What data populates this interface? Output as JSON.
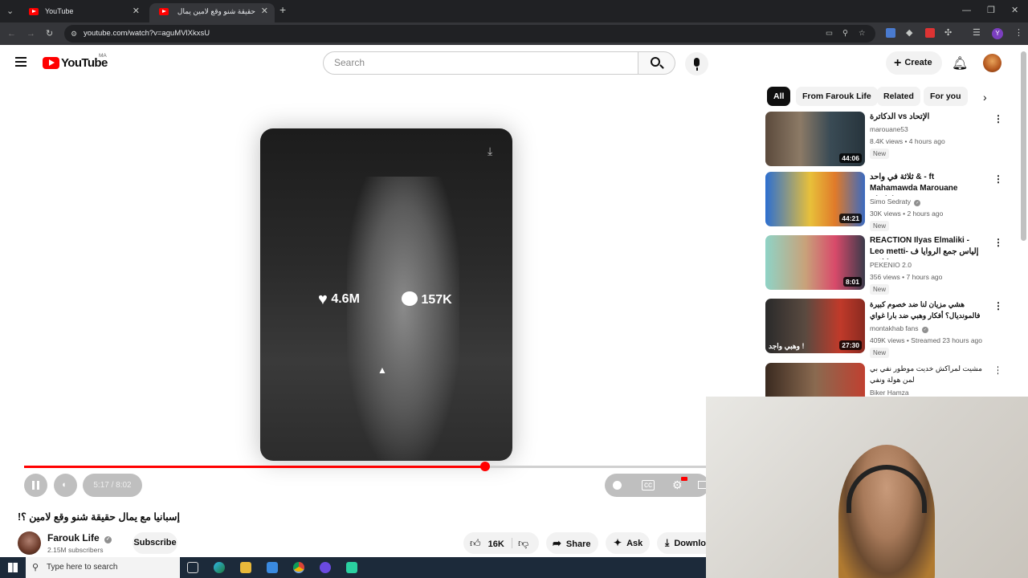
{
  "browser": {
    "tabs": [
      {
        "label": "YouTube"
      },
      {
        "label": "حقيقة شنو وقع لامين يمال ..."
      }
    ],
    "url": "youtube.com/watch?v=aguMVlXkxsU"
  },
  "yt": {
    "logo_text": "YouTube",
    "region": "MA",
    "search_placeholder": "Search",
    "create_label": "Create"
  },
  "player": {
    "likes": "4.6M",
    "comments": "157K",
    "time": "5:17 / 8:02",
    "progress": 0.66
  },
  "video": {
    "title": "إسبانيا مع يمال حقيقة شنو وقع لامين ؟!",
    "channel": "Farouk Life",
    "subscribers": "2.15M subscribers",
    "subscribe_label": "Subscribe",
    "like_count": "16K",
    "share_label": "Share",
    "ask_label": "Ask",
    "download_label": "Downlo"
  },
  "chips": [
    "All",
    "From Farouk Life",
    "Related",
    "For you"
  ],
  "recommendations": [
    {
      "title": "الإتحاد vs الدكاترة",
      "channel": "marouane53",
      "meta": "8.4K views • 4 hours ago",
      "duration": "44:06",
      "badge": "New",
      "verified": false
    },
    {
      "title": "ثلاثة في واحد & - ft Mahamawda Marouane Nbalsi",
      "channel": "Simo Sedraty",
      "meta": "30K views • 2 hours ago",
      "duration": "44:21",
      "badge": "New",
      "verified": true
    },
    {
      "title": "REACTION Ilyas Elmaliki -Leo metti- إلياس جمع الروايا ف كلاش",
      "channel": "PEKENIO 2.0",
      "meta": "356 views • 7 hours ago",
      "duration": "8:01",
      "badge": "New",
      "verified": false
    },
    {
      "title": "هشي مزيان لنا ضد خصوم كبيرة فالمونديال؟ أفكار وهبي ضد بارا غواي",
      "channel": "montakhab fans",
      "meta": "409K views • Streamed 23 hours ago",
      "duration": "27:30",
      "badge": "New",
      "verified": true
    },
    {
      "title": "مشيت لمراكش خديت موطور نفي بي لمن هولة ونفي",
      "channel": "Biker Hamza",
      "meta": "",
      "duration": "",
      "badge": "",
      "verified": false
    }
  ],
  "thumb_overlay_text": "وهبي واجد !",
  "taskbar": {
    "search_placeholder": "Type here to search"
  }
}
